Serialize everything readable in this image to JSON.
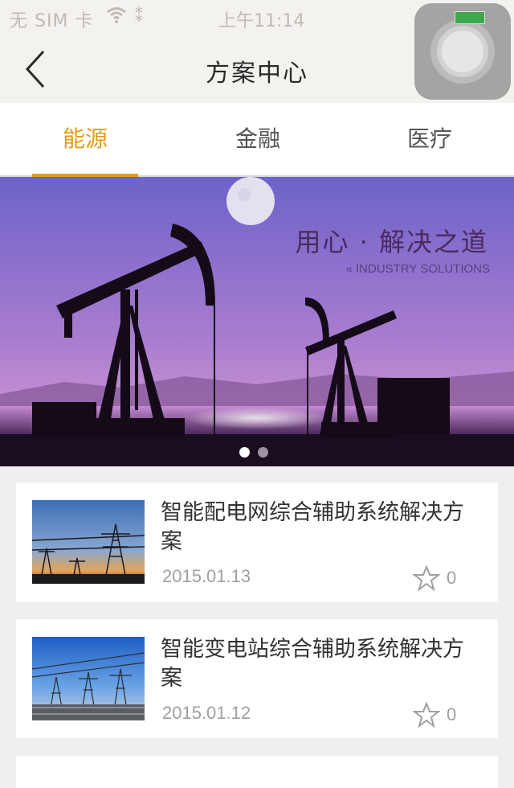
{
  "status_bar": {
    "carrier": "无 SIM 卡",
    "time": "上午11:14"
  },
  "nav": {
    "title": "方案中心",
    "back_icon": "chevron-left-icon"
  },
  "tabs": [
    {
      "label": "能源",
      "active": true
    },
    {
      "label": "金融",
      "active": false
    },
    {
      "label": "医疗",
      "active": false
    }
  ],
  "banner": {
    "title": "用心 · 解决之道",
    "subtitle": "INDUSTRY SOLUTIONS",
    "slide_count": 2,
    "active_slide": 1
  },
  "solutions": [
    {
      "title": "智能配电网综合辅助系统解决方案",
      "date": "2015.01.13",
      "favorites": "0"
    },
    {
      "title": "智能变电站综合辅助系统解决方案",
      "date": "2015.01.12",
      "favorites": "0"
    }
  ],
  "colors": {
    "accent": "#e59b16",
    "nav_bg": "#f4f2ee",
    "page_bg": "#efefef"
  }
}
